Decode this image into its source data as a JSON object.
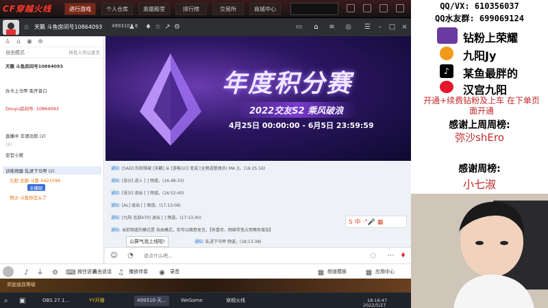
{
  "game_bar": {
    "logo": "CF穿越火线",
    "tabs": [
      "进行游戏",
      "个人仓库",
      "英雄殿堂",
      "排行榜",
      "交易所",
      "商城中心"
    ]
  },
  "yy": {
    "channel_name": "天籁 斗鱼房间号10864093",
    "channel_id": "499310",
    "online_count": "6",
    "left": {
      "mode_label": "自由模式 ·",
      "mode_hint": "所有人可以发言",
      "rows": [
        {
          "text": "天籁 斗鱼房间号10864093",
          "style": "bold"
        },
        {
          "text": "办卡上马甲 免开普口",
          "style": "normal"
        },
        {
          "text": "Douyu房间号: 10864093",
          "style": "red"
        },
        {
          "text": "直播中 丰语功就 (2)",
          "style": "normal"
        },
        {
          "text": "(2)",
          "style": "gray"
        },
        {
          "text": "安官小窝",
          "style": "normal"
        },
        {
          "text": "训练频器 乱进下马甲 (2)",
          "style": "normal"
        },
        {
          "text": "九阳 北部 斗鱼 5421596",
          "style": "orange"
        },
        {
          "text": "快沙 斗鱼你怎么了",
          "style": "orange"
        }
      ],
      "tooltip": "主播助"
    },
    "banner": {
      "title": "年度积分赛",
      "subtitle": "2022交友S2 乘风破浪",
      "date": "4月25日 00:00:00 - 6月5日 23:59:59"
    },
    "messages": [
      {
        "label": "通知:",
        "text": "[SAD] 的权限被 [天籁] 从 [游客(U)] 变成 [全频道管理员( MA )]。(16:25:16)"
      },
      {
        "label": "通知:",
        "text": "[张沙] 进入 [ ] 频道。(16:48:33)"
      },
      {
        "label": "通知:",
        "text": "[张沙] 退出 [ ] 频道。(16:52:40)"
      },
      {
        "label": "通知:",
        "text": "[AL] 退出 [ ] 频道。(17:13:08)"
      },
      {
        "label": "通知:",
        "text": "[九阳 北部470] 退出 [ ] 频道。(17:13:40)"
      },
      {
        "label": "通知:",
        "text": "当前频道的模式是 自由模式，你可以随意发言。【有喜欢、网络带宽占用略有增加】"
      },
      {
        "label": "通知:",
        "text": "乱进下马甲 频道。(18:13:38)"
      }
    ],
    "chat_popup": "公屏气泡上线啦!",
    "input_placeholder": "说点什么吧...",
    "bottom": {
      "press_talk": "按住说话",
      "talk_mode": "自由说话",
      "music": "播放伴奏",
      "record": "录音",
      "template": "频道模板",
      "app_center": "应用中心"
    }
  },
  "right_panel": {
    "qq_line": "QQ/VX: 610356037",
    "qq_group": "QQ水友群: 699069124",
    "brands": [
      {
        "icon": "honor-icon",
        "text": "钻粉上荣耀"
      },
      {
        "icon": "douyu-icon",
        "text": "九阳Jy"
      },
      {
        "icon": "tiktok-icon",
        "text": "某鱼最胖的"
      },
      {
        "icon": "weibo-icon",
        "text": "汉宫九阳"
      }
    ],
    "note": "开通+续费钻粉及上车 在下单页面开通",
    "thanks_week_title": "感谢上周周榜:",
    "thanks_week_name": "弥沙shEro",
    "thanks_title": "感谢周榜:",
    "thanks_name": "小七淑"
  },
  "taskbar": {
    "items": [
      "OBS 27.1...",
      "YY开播",
      "499310-天...",
      "WeGame",
      "穿越火线"
    ],
    "time": "18:16:47",
    "date": "2022/5/27",
    "strip_text": "奖励道具等级"
  }
}
